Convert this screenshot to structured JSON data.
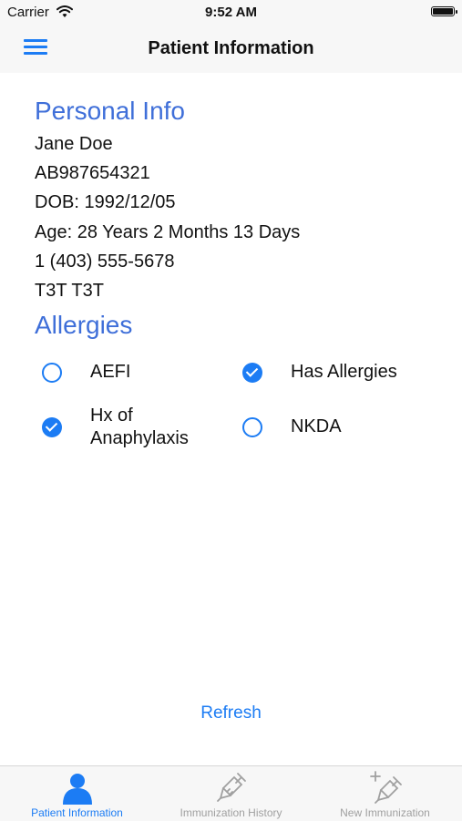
{
  "status": {
    "carrier": "Carrier",
    "time": "9:52 AM"
  },
  "nav": {
    "title": "Patient Information"
  },
  "personal": {
    "heading": "Personal Info",
    "name": "Jane Doe",
    "id": "AB987654321",
    "dob": "DOB: 1992/12/05",
    "age": "Age: 28 Years 2 Months 13 Days",
    "phone": "1 (403) 555-5678",
    "postal": "T3T T3T"
  },
  "allergies": {
    "heading": "Allergies",
    "items": [
      {
        "label": "AEFI",
        "checked": false
      },
      {
        "label": "Has Allergies",
        "checked": true
      },
      {
        "label": "Hx of\nAnaphylaxis",
        "checked": true
      },
      {
        "label": "NKDA",
        "checked": false
      }
    ]
  },
  "refresh_label": "Refresh",
  "tabs": [
    {
      "label": "Patient Information",
      "icon": "person-icon",
      "active": true
    },
    {
      "label": "Immunization History",
      "icon": "syringe-icon",
      "active": false
    },
    {
      "label": "New Immunization",
      "icon": "add-syringe-icon",
      "active": false
    }
  ],
  "colors": {
    "accent": "#1c7cf4",
    "heading": "#3f6fd9",
    "bar": "#f7f7f7",
    "inactive_tab": "#a0a0a0"
  }
}
